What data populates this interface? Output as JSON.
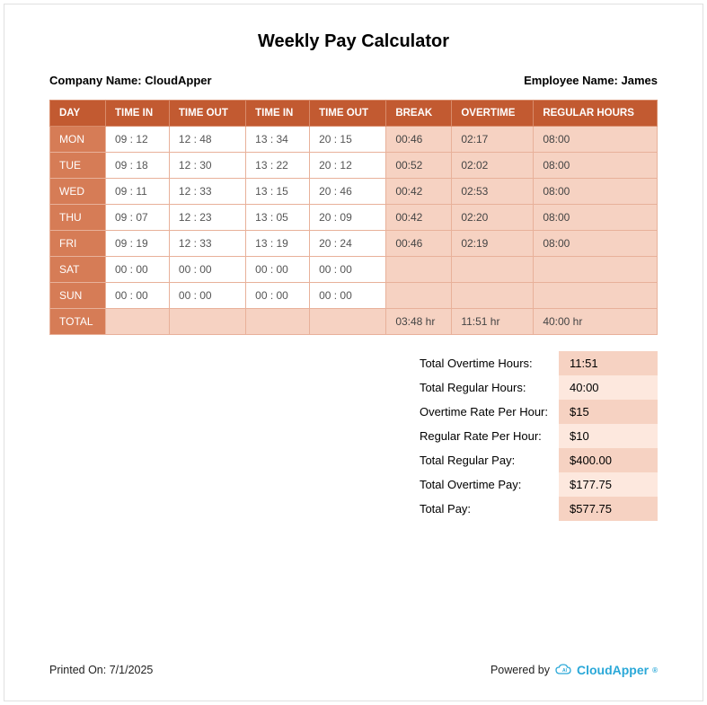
{
  "title": "Weekly Pay Calculator",
  "company_label": "Company Name:",
  "company_name": "CloudApper",
  "employee_label": "Employee Name:",
  "employee_name": "James",
  "headers": {
    "day": "DAY",
    "time_in1": "TIME IN",
    "time_out1": "TIME OUT",
    "time_in2": "TIME IN",
    "time_out2": "TIME OUT",
    "break": "BREAK",
    "overtime": "OVERTIME",
    "regular": "REGULAR HOURS"
  },
  "rows": [
    {
      "day": "MON",
      "in1": "09 : 12",
      "out1": "12 : 48",
      "in2": "13 : 34",
      "out2": "20 : 15",
      "break": "00:46",
      "ot": "02:17",
      "reg": "08:00"
    },
    {
      "day": "TUE",
      "in1": "09 : 18",
      "out1": "12 : 30",
      "in2": "13 : 22",
      "out2": "20 : 12",
      "break": "00:52",
      "ot": "02:02",
      "reg": "08:00"
    },
    {
      "day": "WED",
      "in1": "09 : 11",
      "out1": "12 : 33",
      "in2": "13 : 15",
      "out2": "20 : 46",
      "break": "00:42",
      "ot": "02:53",
      "reg": "08:00"
    },
    {
      "day": "THU",
      "in1": "09 : 07",
      "out1": "12 : 23",
      "in2": "13 : 05",
      "out2": "20 : 09",
      "break": "00:42",
      "ot": "02:20",
      "reg": "08:00"
    },
    {
      "day": "FRI",
      "in1": "09 : 19",
      "out1": "12 : 33",
      "in2": "13 : 19",
      "out2": "20 : 24",
      "break": "00:46",
      "ot": "02:19",
      "reg": "08:00"
    },
    {
      "day": "SAT",
      "in1": "00 : 00",
      "out1": "00 : 00",
      "in2": "00 : 00",
      "out2": "00 : 00",
      "break": "",
      "ot": "",
      "reg": ""
    },
    {
      "day": "SUN",
      "in1": "00 : 00",
      "out1": "00 : 00",
      "in2": "00 : 00",
      "out2": "00 : 00",
      "break": "",
      "ot": "",
      "reg": ""
    }
  ],
  "total_row": {
    "label": "TOTAL",
    "break": "03:48 hr",
    "ot": "11:51 hr",
    "reg": "40:00 hr"
  },
  "summary": [
    {
      "label": "Total Overtime Hours:",
      "value": "11:51"
    },
    {
      "label": "Total Regular Hours:",
      "value": "40:00"
    },
    {
      "label": "Overtime Rate Per Hour:",
      "value": "$15"
    },
    {
      "label": "Regular Rate Per Hour:",
      "value": "$10"
    },
    {
      "label": "Total Regular Pay:",
      "value": "$400.00"
    },
    {
      "label": "Total Overtime Pay:",
      "value": "$177.75"
    },
    {
      "label": "Total Pay:",
      "value": "$577.75"
    }
  ],
  "footer": {
    "printed_label": "Printed On:",
    "printed_date": "7/1/2025",
    "powered_label": "Powered by",
    "brand": "CloudApper"
  }
}
